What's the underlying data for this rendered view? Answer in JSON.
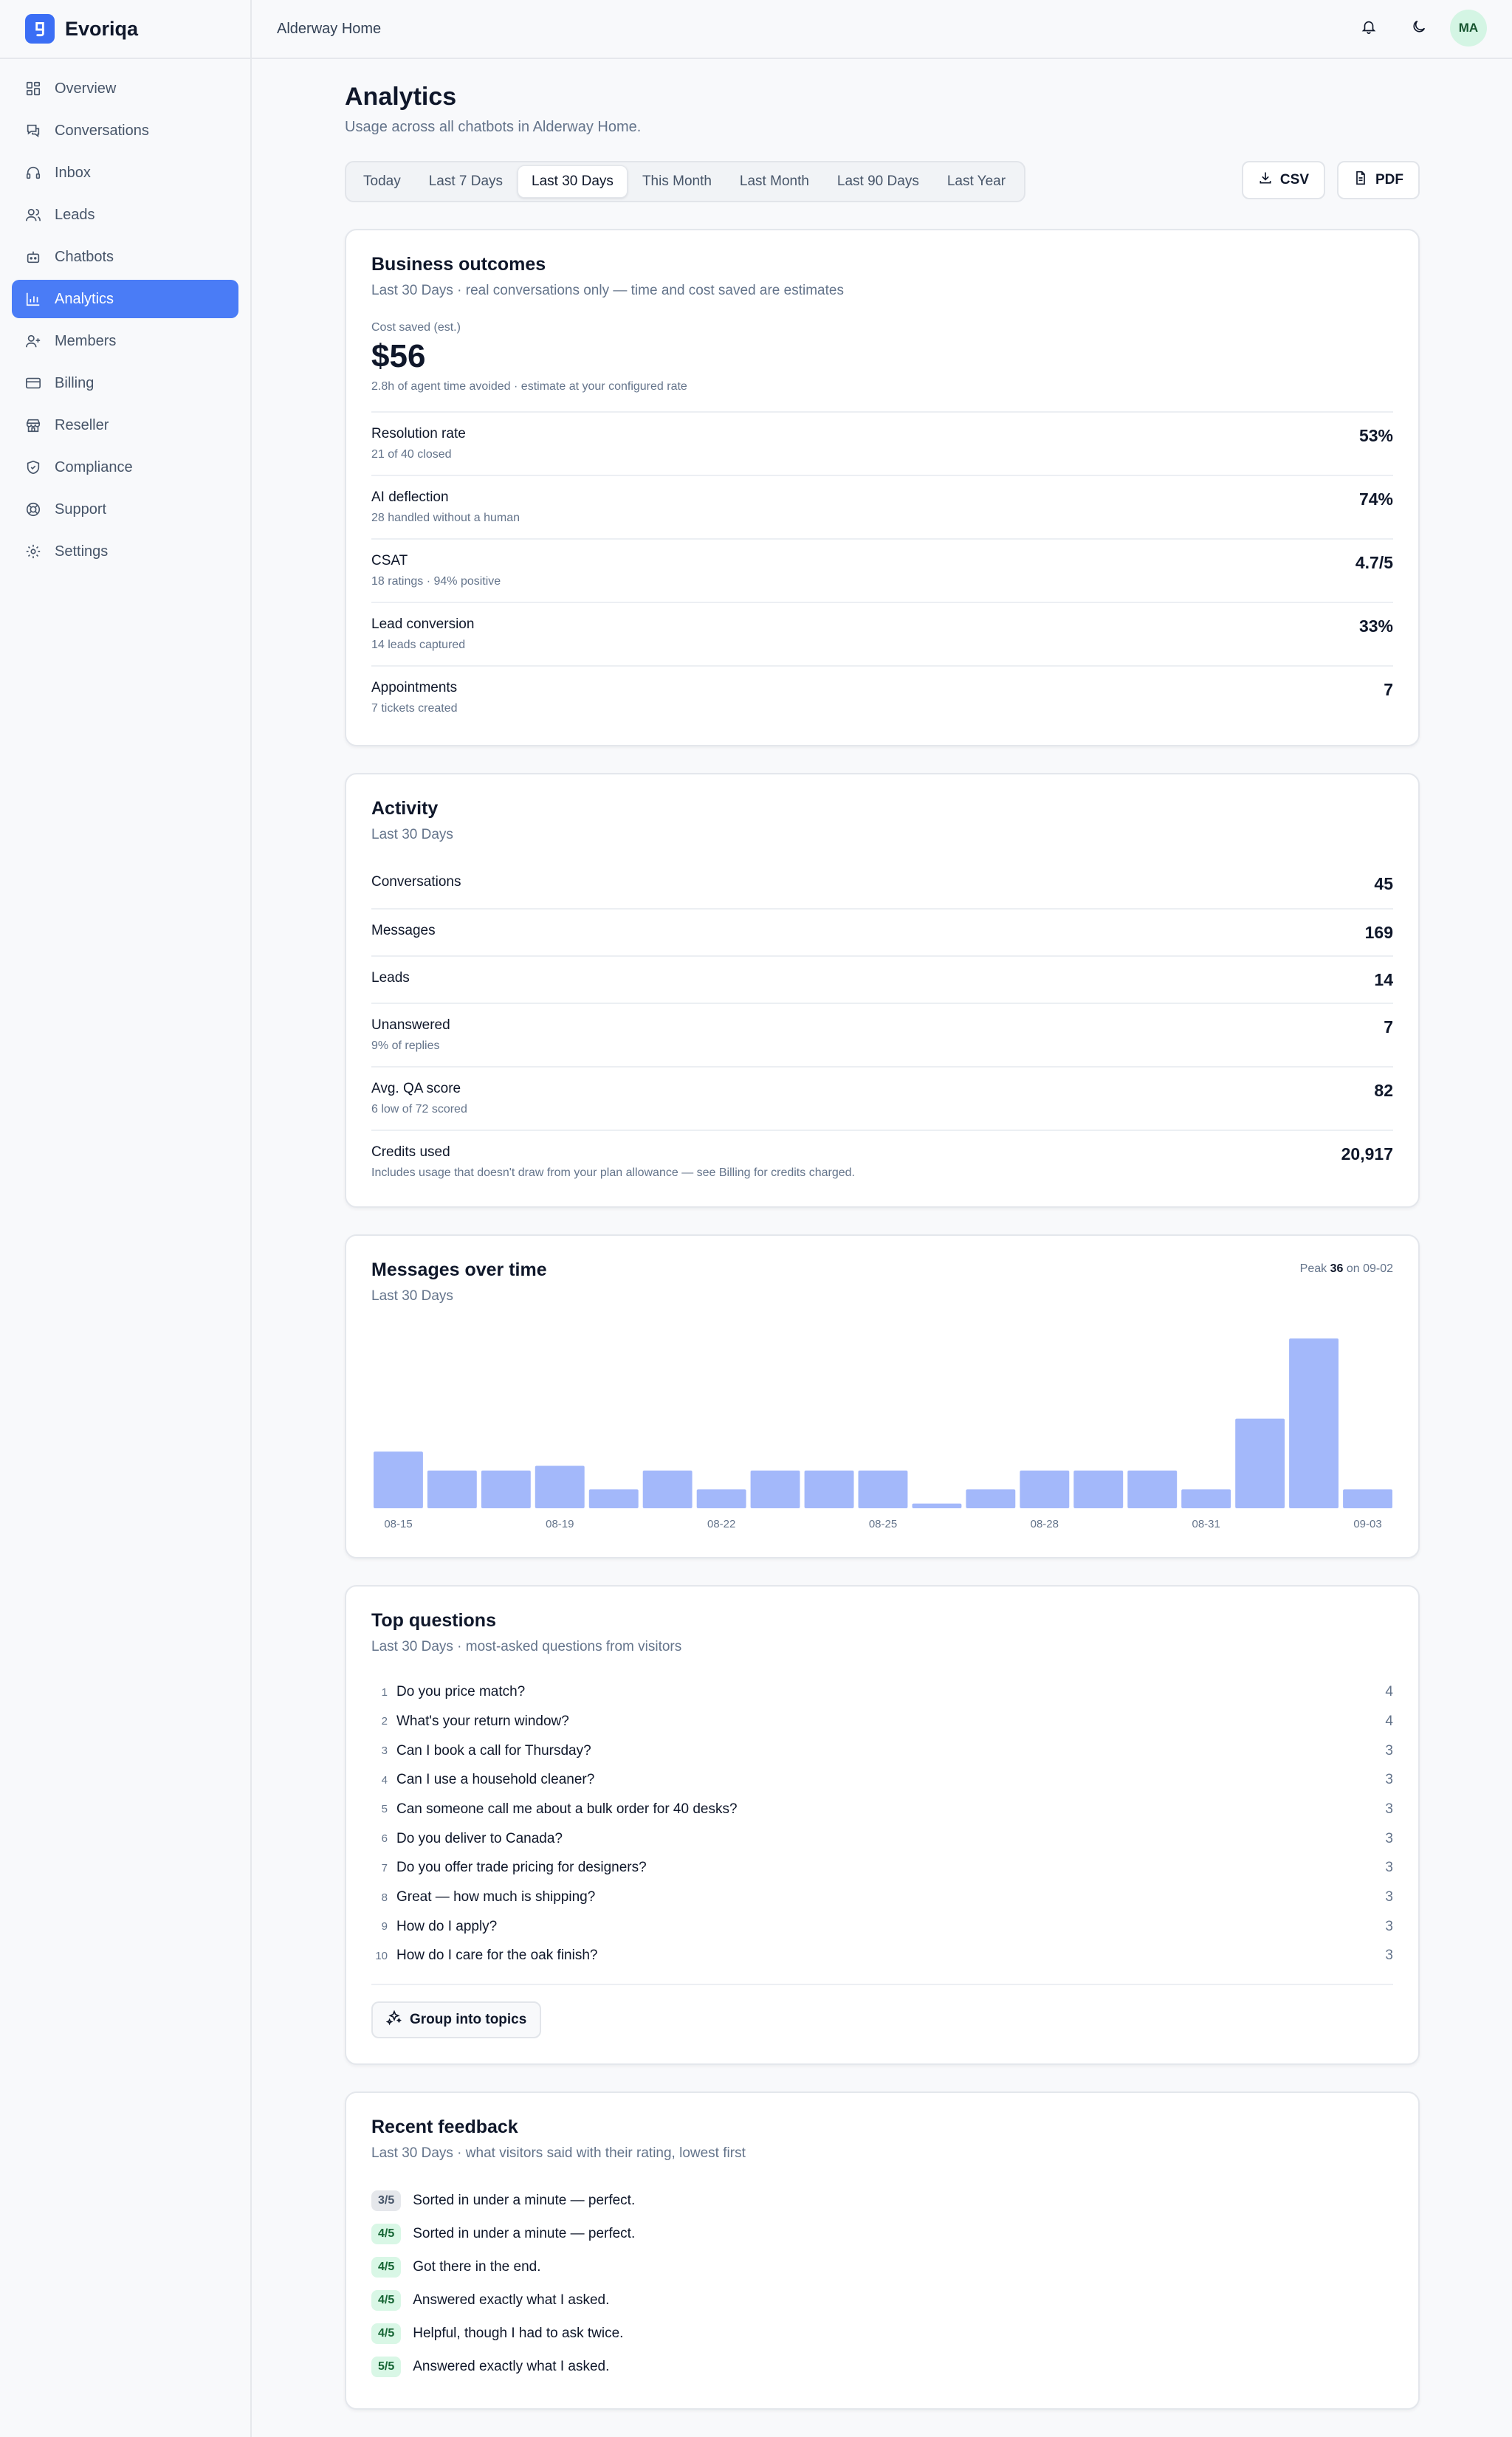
{
  "brand": {
    "name": "Evoriqa"
  },
  "topbar": {
    "workspace": "Alderway Home",
    "avatar_initials": "MA"
  },
  "sidebar": {
    "items": [
      {
        "label": "Overview",
        "icon": "grid-icon",
        "active": false
      },
      {
        "label": "Conversations",
        "icon": "chat-icon",
        "active": false
      },
      {
        "label": "Inbox",
        "icon": "headset-icon",
        "active": false
      },
      {
        "label": "Leads",
        "icon": "users-icon",
        "active": false
      },
      {
        "label": "Chatbots",
        "icon": "bot-icon",
        "active": false
      },
      {
        "label": "Analytics",
        "icon": "bar-chart-icon",
        "active": true
      },
      {
        "label": "Members",
        "icon": "user-plus-icon",
        "active": false
      },
      {
        "label": "Billing",
        "icon": "credit-card-icon",
        "active": false
      },
      {
        "label": "Reseller",
        "icon": "store-icon",
        "active": false
      },
      {
        "label": "Compliance",
        "icon": "shield-icon",
        "active": false
      },
      {
        "label": "Support",
        "icon": "lifebuoy-icon",
        "active": false
      },
      {
        "label": "Settings",
        "icon": "gear-icon",
        "active": false
      }
    ]
  },
  "page": {
    "title": "Analytics",
    "subtitle": "Usage across all chatbots in Alderway Home."
  },
  "range_tabs": [
    {
      "label": "Today",
      "active": false
    },
    {
      "label": "Last 7 Days",
      "active": false
    },
    {
      "label": "Last 30 Days",
      "active": true
    },
    {
      "label": "This Month",
      "active": false
    },
    {
      "label": "Last Month",
      "active": false
    },
    {
      "label": "Last 90 Days",
      "active": false
    },
    {
      "label": "Last Year",
      "active": false
    }
  ],
  "export": {
    "csv_label": "CSV",
    "pdf_label": "PDF"
  },
  "business": {
    "title": "Business outcomes",
    "subtitle": "Last 30 Days · real conversations only — time and cost saved are estimates",
    "hero_label": "Cost saved (est.)",
    "hero_value": "$56",
    "hero_note": "2.8h of agent time avoided · estimate at your configured rate",
    "rows": [
      {
        "label": "Resolution rate",
        "sub": "21 of 40 closed",
        "value": "53%"
      },
      {
        "label": "AI deflection",
        "sub": "28 handled without a human",
        "value": "74%"
      },
      {
        "label": "CSAT",
        "sub": "18 ratings · 94% positive",
        "value": "4.7/5"
      },
      {
        "label": "Lead conversion",
        "sub": "14 leads captured",
        "value": "33%"
      },
      {
        "label": "Appointments",
        "sub": "7 tickets created",
        "value": "7"
      }
    ]
  },
  "activity": {
    "title": "Activity",
    "subtitle": "Last 30 Days",
    "rows": [
      {
        "label": "Conversations",
        "sub": "",
        "value": "45"
      },
      {
        "label": "Messages",
        "sub": "",
        "value": "169"
      },
      {
        "label": "Leads",
        "sub": "",
        "value": "14"
      },
      {
        "label": "Unanswered",
        "sub": "9% of replies",
        "value": "7"
      },
      {
        "label": "Avg. QA score",
        "sub": "6 low of 72 scored",
        "value": "82"
      },
      {
        "label": "Credits used",
        "sub": "Includes usage that doesn't draw from your plan allowance — see Billing for credits charged.",
        "value": "20,917"
      }
    ]
  },
  "messages_chart": {
    "title": "Messages over time",
    "subtitle": "Last 30 Days",
    "peak_prefix": "Peak",
    "peak_value": "36",
    "peak_suffix": "on 09-02"
  },
  "chart_data": {
    "type": "bar",
    "categories": [
      "08-15",
      "08-16",
      "08-17",
      "08-18",
      "08-19",
      "08-20",
      "08-21",
      "08-22",
      "08-23",
      "08-24",
      "08-25",
      "08-26",
      "08-27",
      "08-28",
      "08-29",
      "08-30",
      "08-31",
      "09-01",
      "09-02",
      "09-03"
    ],
    "tick_labels": [
      "08-15",
      "08-19",
      "08-22",
      "08-25",
      "08-28",
      "08-31",
      "09-03"
    ],
    "tick_indices": [
      0,
      3,
      6,
      9,
      12,
      15,
      19
    ],
    "values": [
      12,
      8,
      8,
      9,
      4,
      8,
      4,
      8,
      8,
      8,
      1,
      4,
      8,
      8,
      8,
      4,
      19,
      36,
      4
    ],
    "ylim": [
      0,
      36
    ],
    "color": "#a3b8fa",
    "grid": false
  },
  "questions": {
    "title": "Top questions",
    "subtitle": "Last 30 Days · most-asked questions from visitors",
    "items": [
      {
        "rank": "1",
        "text": "Do you price match?",
        "count": "4"
      },
      {
        "rank": "2",
        "text": "What's your return window?",
        "count": "4"
      },
      {
        "rank": "3",
        "text": "Can I book a call for Thursday?",
        "count": "3"
      },
      {
        "rank": "4",
        "text": "Can I use a household cleaner?",
        "count": "3"
      },
      {
        "rank": "5",
        "text": "Can someone call me about a bulk order for 40 desks?",
        "count": "3"
      },
      {
        "rank": "6",
        "text": "Do you deliver to Canada?",
        "count": "3"
      },
      {
        "rank": "7",
        "text": "Do you offer trade pricing for designers?",
        "count": "3"
      },
      {
        "rank": "8",
        "text": "Great — how much is shipping?",
        "count": "3"
      },
      {
        "rank": "9",
        "text": "How do I apply?",
        "count": "3"
      },
      {
        "rank": "10",
        "text": "How do I care for the oak finish?",
        "count": "3"
      }
    ],
    "group_label": "Group into topics"
  },
  "feedback": {
    "title": "Recent feedback",
    "subtitle": "Last 30 Days · what visitors said with their rating, lowest first",
    "items": [
      {
        "rating": "3/5",
        "text": "Sorted in under a minute — perfect.",
        "tone": "mid"
      },
      {
        "rating": "4/5",
        "text": "Sorted in under a minute — perfect.",
        "tone": "good"
      },
      {
        "rating": "4/5",
        "text": "Got there in the end.",
        "tone": "good"
      },
      {
        "rating": "4/5",
        "text": "Answered exactly what I asked.",
        "tone": "good"
      },
      {
        "rating": "4/5",
        "text": "Helpful, though I had to ask twice.",
        "tone": "good"
      },
      {
        "rating": "5/5",
        "text": "Answered exactly what I asked.",
        "tone": "good"
      }
    ]
  }
}
